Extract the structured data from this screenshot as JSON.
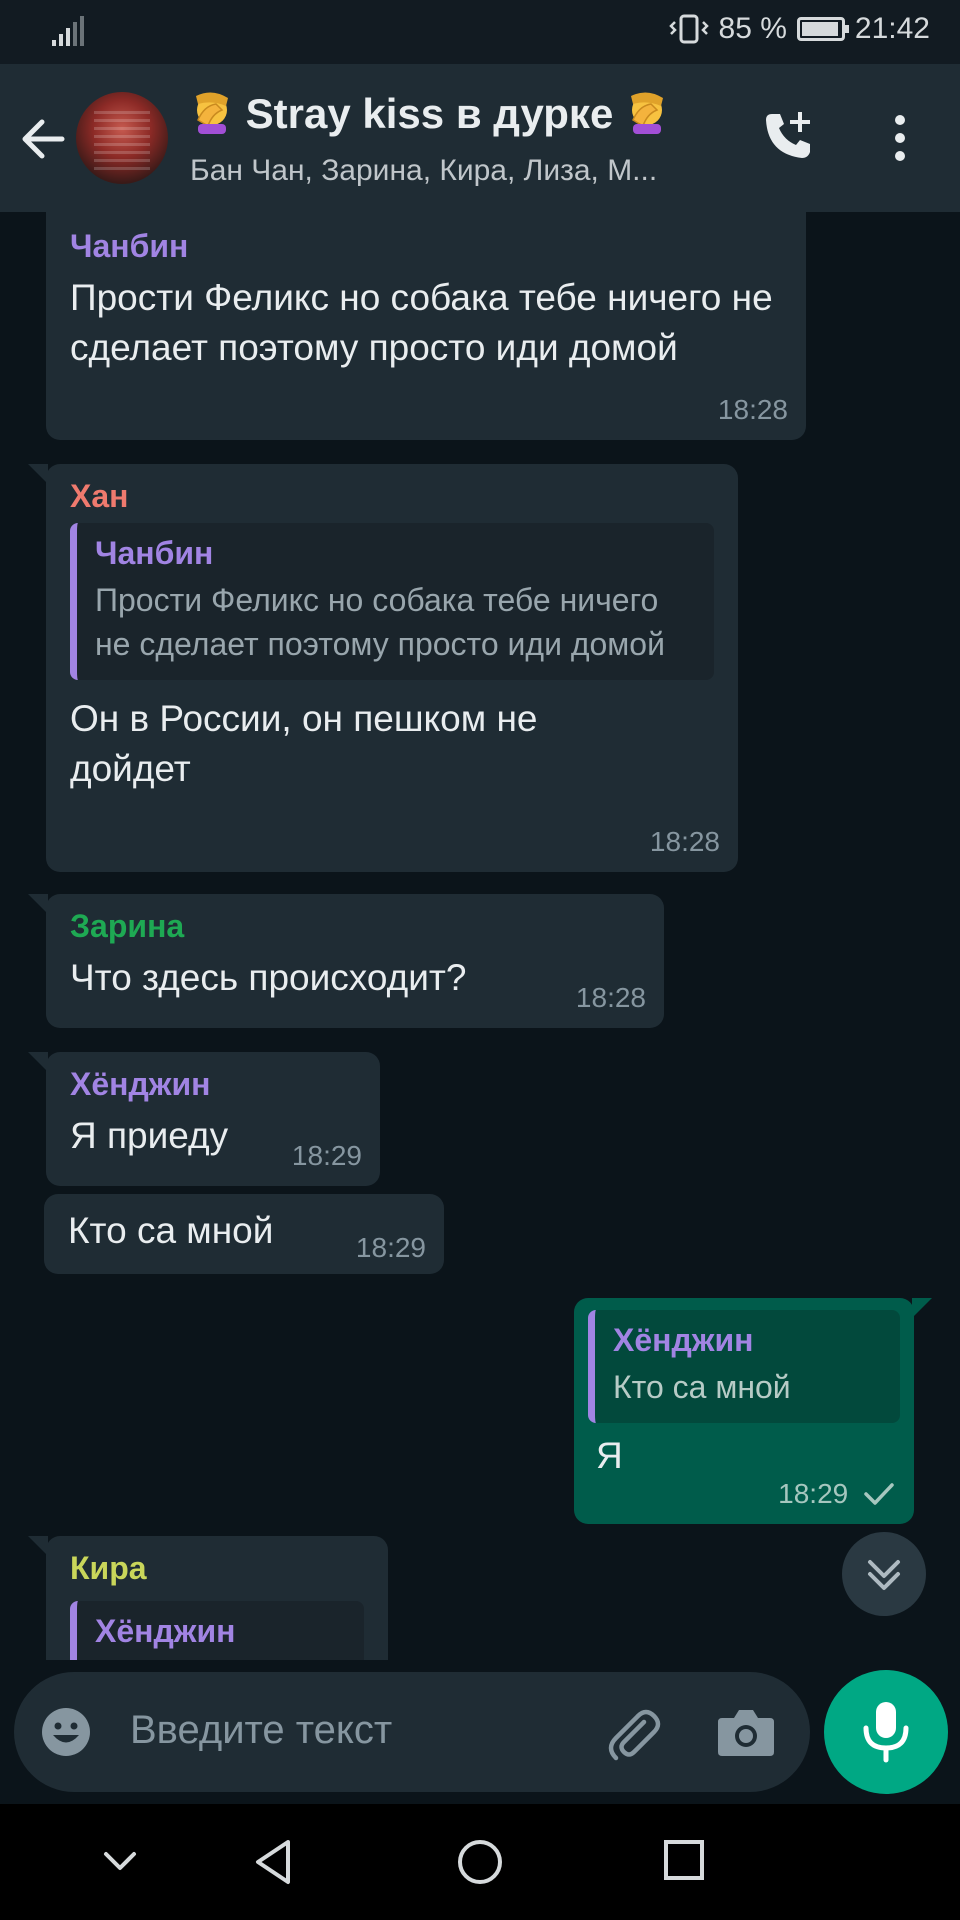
{
  "status_bar": {
    "battery": "85 %",
    "battery_level": 0.85,
    "time": "21:42"
  },
  "chat_header": {
    "title": "Stray kiss в дурке",
    "participants": "Бан Чан, Зарина, Кира, Лиза, М...",
    "title_emoji": "facepalm-emoji"
  },
  "messages": [
    {
      "sender": "Чанбин",
      "sender_color": "#a184e3",
      "text": "Прости Феликс но собака тебе ничего не сделает поэтому просто иди домой",
      "time": "18:28"
    },
    {
      "sender": "Хан",
      "sender_color": "#ef7a6e",
      "quote": {
        "author": "Чанбин",
        "text": "Прости Феликс но собака тебе ничего не сделает поэтому просто иди домой"
      },
      "text": "Он в России, он пешком не дойдет",
      "time": "18:28"
    },
    {
      "sender": "Зарина",
      "sender_color": "#1ea953",
      "text": "Что здесь происходит?",
      "time": "18:28"
    },
    {
      "sender": "Хёнджин",
      "sender_color": "#a184e3",
      "text": "Я приеду",
      "time": "18:29"
    },
    {
      "text": "Кто са мной",
      "time": "18:29"
    },
    {
      "outgoing": true,
      "quote": {
        "author": "Хёнджин",
        "text": "Кто са мной"
      },
      "text": "Я",
      "time": "18:29",
      "status": "sent"
    },
    {
      "sender": "Кира",
      "sender_color": "#c9d65a",
      "quote": {
        "author": "Хёнджин",
        "text": ""
      }
    }
  ],
  "composer": {
    "placeholder": "Введите текст"
  },
  "colors": {
    "background": "#0b141a",
    "bubble_in": "#1f2c34",
    "bubble_out": "#005c4b",
    "accent": "#00a884"
  }
}
